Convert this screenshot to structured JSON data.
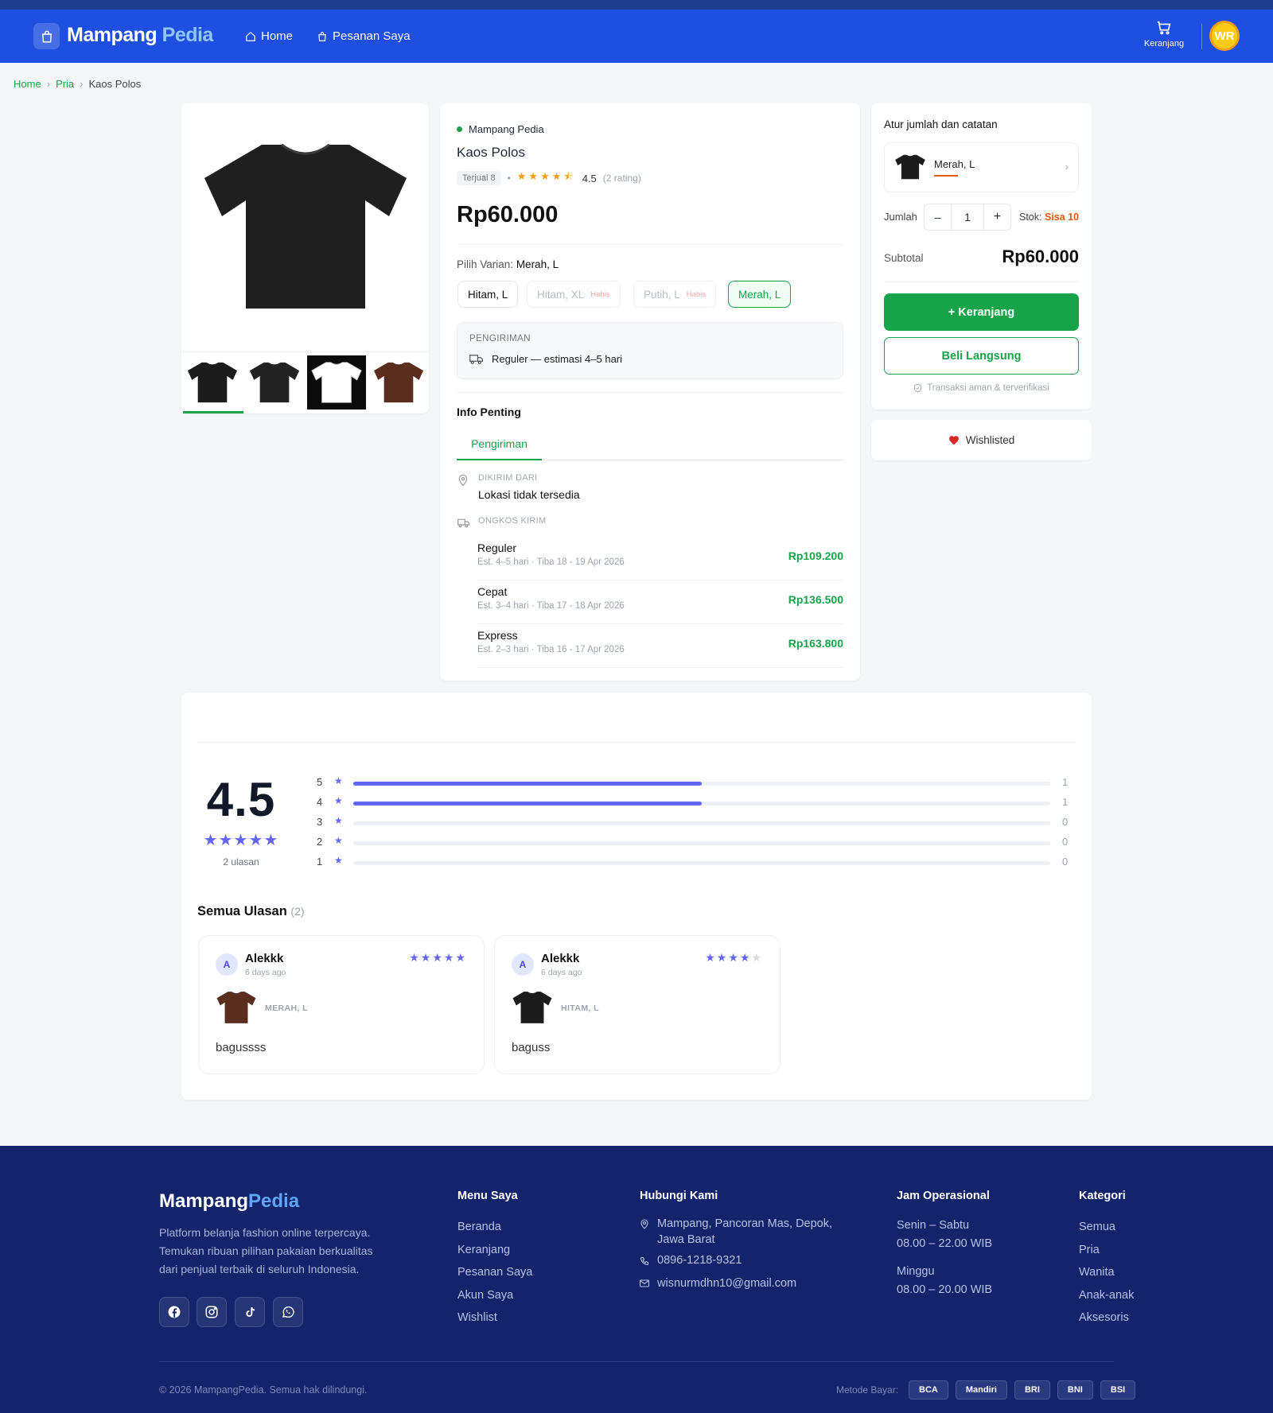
{
  "header": {
    "brand_a": "Mampang",
    "brand_b": "Pedia",
    "nav_home": "Home",
    "nav_orders": "Pesanan Saya",
    "cart_label": "Keranjang",
    "avatar_initials": "WR"
  },
  "breadcrumb": [
    "Home",
    "Pria",
    "Kaos Polos"
  ],
  "product": {
    "store": "Mampang Pedia",
    "name": "Kaos Polos",
    "sold": "Terjual 8",
    "rating": "4.5",
    "rating_count": "(2 rating)",
    "price": "Rp60.000",
    "variant_label": "Pilih Varian:",
    "variant_selected": "Merah, L",
    "variants": [
      {
        "label": "Hitam, L",
        "status": ""
      },
      {
        "label": "Hitam, XL",
        "status": "Habis"
      },
      {
        "label": "Putih, L",
        "status": "Habis"
      },
      {
        "label": "Merah, L",
        "status": ""
      }
    ],
    "shipping_head": "PENGIRIMAN",
    "shipping_text": "Reguler — estimasi 4–5 hari",
    "info_title": "Info Penting",
    "info_tab": "Pengiriman",
    "from_label": "DIKIRIM DARI",
    "from_value": "Lokasi tidak tersedia",
    "cost_label": "ONGKOS KIRIM",
    "shipping_options": [
      {
        "name": "Reguler",
        "est": "Est. 4–5 hari · Tiba 18 - 19 Apr 2026",
        "price": "Rp109.200"
      },
      {
        "name": "Cepat",
        "est": "Est. 3–4 hari · Tiba 17 - 18 Apr 2026",
        "price": "Rp136.500"
      },
      {
        "name": "Express",
        "est": "Est. 2–3 hari · Tiba 16 - 17 Apr 2026",
        "price": "Rp163.800"
      }
    ],
    "thumb_colors": [
      "#1c1c1c",
      "#232323",
      "#ffffff",
      "#5a2e1f"
    ]
  },
  "purchase": {
    "title": "Atur jumlah dan catatan",
    "variant": "Merah, L",
    "qty_label": "Jumlah",
    "qty": "1",
    "minus": "–",
    "plus": "+",
    "stock_label": "Stok:",
    "stock_value": "Sisa 10",
    "subtotal_label": "Subtotal",
    "subtotal": "Rp60.000",
    "add_cart": "+ Keranjang",
    "buy_now": "Beli Langsung",
    "secure": "Transaksi aman & terverifikasi",
    "wishlist": "Wishlisted"
  },
  "reviews": {
    "average": "4.5",
    "count_label": "2 ulasan",
    "distribution": [
      {
        "star": "5",
        "count": "1",
        "fraction": 0.5
      },
      {
        "star": "4",
        "count": "1",
        "fraction": 0.5
      },
      {
        "star": "3",
        "count": "0",
        "fraction": 0
      },
      {
        "star": "2",
        "count": "0",
        "fraction": 0
      },
      {
        "star": "1",
        "count": "0",
        "fraction": 0
      }
    ],
    "all_title": "Semua Ulasan",
    "all_count": "(2)",
    "items": [
      {
        "initial": "A",
        "name": "Alekkk",
        "time": "6 days ago",
        "stars": 5,
        "variant": "MERAH, L",
        "text": "bagussss",
        "shirt_color": "#5a2e1f"
      },
      {
        "initial": "A",
        "name": "Alekkk",
        "time": "6 days ago",
        "stars": 4,
        "variant": "HITAM, L",
        "text": "baguss",
        "shirt_color": "#1c1c1c"
      }
    ]
  },
  "footer": {
    "brand_a": "Mampang",
    "brand_b": "Pedia",
    "desc1": "Platform belanja fashion online terpercaya.",
    "desc2": "Temukan ribuan pilihan pakaian berkualitas",
    "desc3": "dari penjual terbaik di seluruh Indonesia.",
    "menu_title": "Menu Saya",
    "menu": [
      "Beranda",
      "Keranjang",
      "Pesanan Saya",
      "Akun Saya",
      "Wishlist"
    ],
    "contact_title": "Hubungi Kami",
    "address1": "Mampang, Pancoran Mas, Depok,",
    "address2": "Jawa Barat",
    "phone": "0896-1218-9321",
    "email": "wisnurmdhn10@gmail.com",
    "hours_title": "Jam Operasional",
    "days1": "Senin – Sabtu",
    "hours1": "08.00 – 22.00 WIB",
    "days2": "Minggu",
    "hours2": "08.00 – 20.00 WIB",
    "cat_title": "Kategori",
    "categories": [
      "Semua",
      "Pria",
      "Wanita",
      "Anak-anak",
      "Aksesoris"
    ],
    "copyright": "© 2026 MampangPedia. Semua hak dilindungi.",
    "payment_label": "Metode Bayar:",
    "banks": [
      "BCA",
      "Mandiri",
      "BRI",
      "BNI",
      "BSI"
    ]
  }
}
